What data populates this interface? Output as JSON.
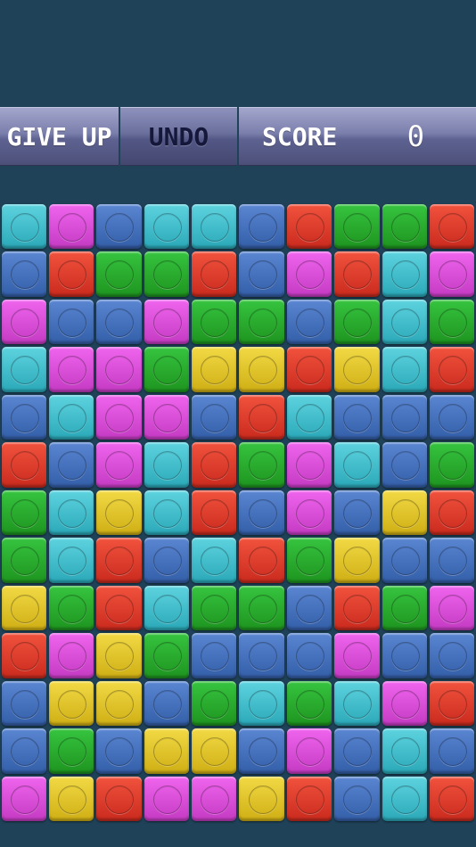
{
  "toolbar": {
    "give_up_label": "GIVE UP",
    "undo_label": "UNDO",
    "score_label": "SCORE",
    "score_value": "0"
  },
  "board": {
    "rows": 13,
    "cols": 10,
    "color_key": {
      "C": "#3ec0cf",
      "M": "#e04fde",
      "B": "#4371bf",
      "R": "#e23f2e",
      "G": "#2aaf31",
      "Y": "#e6c52b"
    },
    "grid": [
      [
        "C",
        "M",
        "B",
        "C",
        "C",
        "B",
        "R",
        "G",
        "G",
        "R"
      ],
      [
        "B",
        "R",
        "G",
        "G",
        "R",
        "B",
        "M",
        "R",
        "C",
        "M"
      ],
      [
        "M",
        "B",
        "B",
        "M",
        "G",
        "G",
        "B",
        "G",
        "C",
        "G"
      ],
      [
        "C",
        "M",
        "M",
        "G",
        "Y",
        "Y",
        "R",
        "Y",
        "C",
        "R"
      ],
      [
        "B",
        "C",
        "M",
        "M",
        "B",
        "R",
        "C",
        "B",
        "B",
        "B"
      ],
      [
        "R",
        "B",
        "M",
        "C",
        "R",
        "G",
        "M",
        "C",
        "B",
        "G"
      ],
      [
        "G",
        "C",
        "Y",
        "C",
        "R",
        "B",
        "M",
        "B",
        "Y",
        "R"
      ],
      [
        "G",
        "C",
        "R",
        "B",
        "C",
        "R",
        "G",
        "Y",
        "B",
        "B"
      ],
      [
        "Y",
        "G",
        "R",
        "C",
        "G",
        "G",
        "B",
        "R",
        "G",
        "M"
      ],
      [
        "R",
        "M",
        "Y",
        "G",
        "B",
        "B",
        "B",
        "M",
        "B",
        "B"
      ],
      [
        "B",
        "Y",
        "Y",
        "B",
        "G",
        "C",
        "G",
        "C",
        "M",
        "R"
      ],
      [
        "B",
        "G",
        "B",
        "Y",
        "Y",
        "B",
        "M",
        "B",
        "C",
        "B"
      ],
      [
        "M",
        "Y",
        "R",
        "M",
        "M",
        "Y",
        "R",
        "B",
        "C",
        "R"
      ]
    ]
  }
}
